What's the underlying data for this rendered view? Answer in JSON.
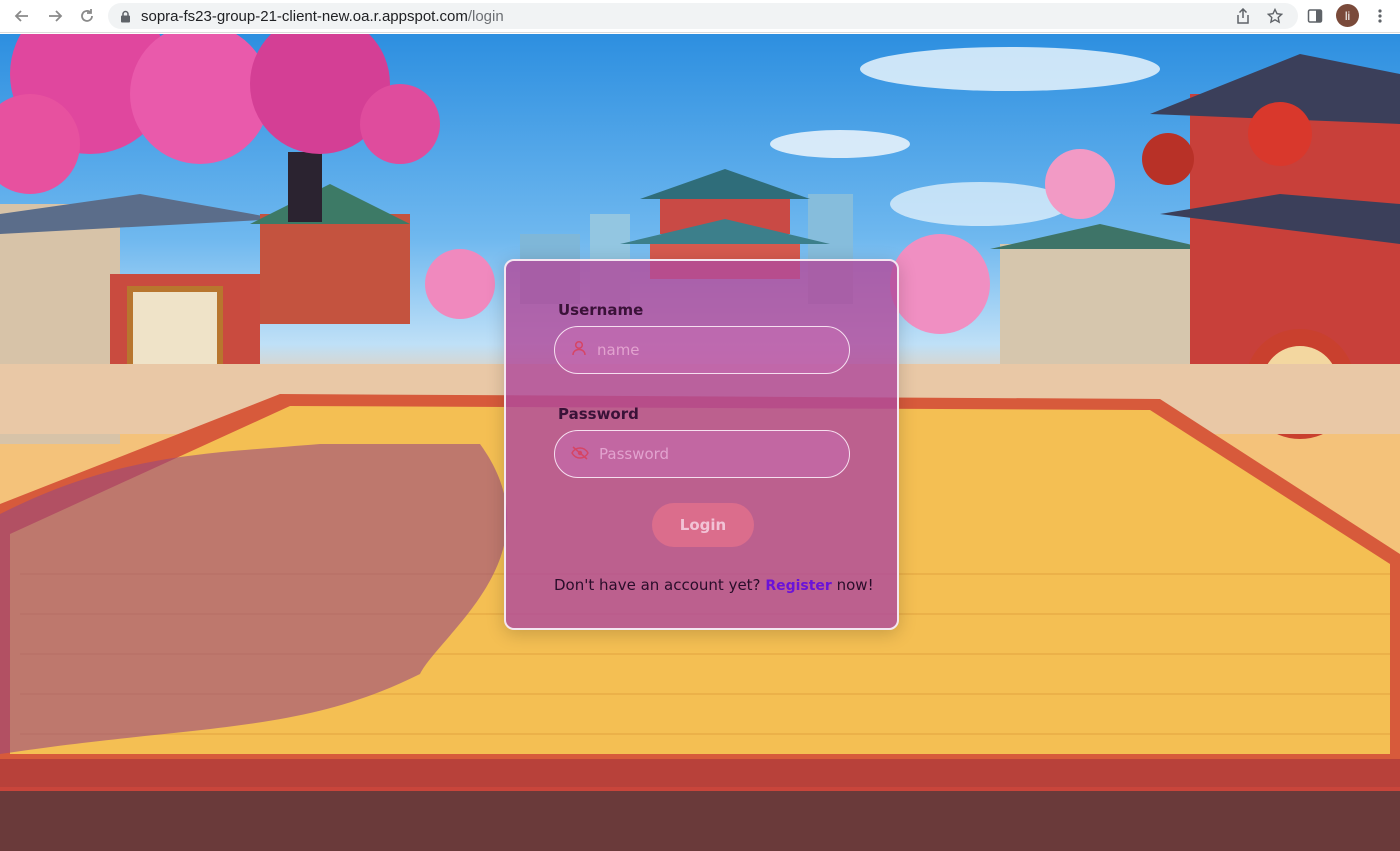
{
  "browser": {
    "url_host": "sopra-fs23-group-21-client-new.oa.r.appspot.com",
    "url_path": "/login",
    "avatar_initial": "li"
  },
  "login": {
    "username_label": "Username",
    "username_placeholder": "name",
    "password_label": "Password",
    "password_placeholder": "Password",
    "login_button": "Login",
    "footer_prefix": "Don't have an account yet?",
    "register_link": "Register",
    "footer_suffix": "now!"
  },
  "colors": {
    "card_bg": "#b04a9b",
    "register_link": "#6a12d9",
    "login_button": "#e0708c"
  },
  "icons": {
    "username": "user-icon",
    "password": "eye-slash-icon"
  }
}
